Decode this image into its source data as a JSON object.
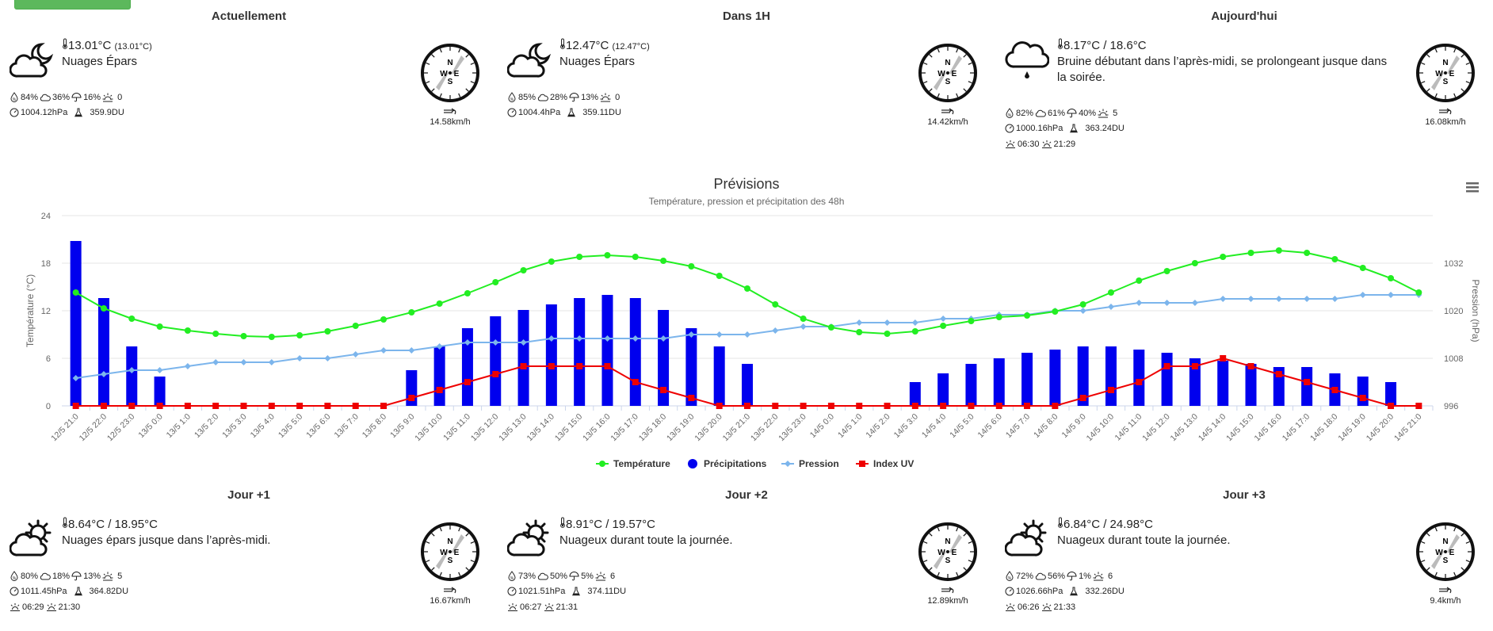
{
  "panels": [
    {
      "title": "Actuellement",
      "temp_main": "13.01°C",
      "temp_feel": "(13.01°C)",
      "desc": "Nuages Épars",
      "humidity": "84%",
      "cloud": "36%",
      "precip": "16%",
      "uv": "0",
      "pressure": "1004.12hPa",
      "ozone": "359.9DU",
      "sun": "",
      "wind": "14.58km/h",
      "icon": "partly-cloudy-night-icon"
    },
    {
      "title": "Dans 1H",
      "temp_main": "12.47°C",
      "temp_feel": "(12.47°C)",
      "desc": "Nuages Épars",
      "humidity": "85%",
      "cloud": "28%",
      "precip": "13%",
      "uv": "0",
      "pressure": "1004.4hPa",
      "ozone": "359.11DU",
      "sun": "",
      "wind": "14.42km/h",
      "icon": "partly-cloudy-night-icon"
    },
    {
      "title": "Aujourd'hui",
      "temp_main": "8.17°C /  18.6°C",
      "temp_feel": "",
      "desc": " Bruine débutant dans l’après-midi, se prolongeant jusque dans la soirée.",
      "humidity": "82%",
      "cloud": "61%",
      "precip": "40%",
      "uv": "5",
      "pressure": "1000.16hPa",
      "ozone": "363.24DU",
      "sunrise": "06:30",
      "sunset": "21:29",
      "wind": "16.08km/h",
      "icon": "drizzle-icon"
    },
    {
      "title": "Jour +1",
      "temp_main": "8.64°C /  18.95°C",
      "temp_feel": "",
      "desc": "Nuages épars jusque dans l’après-midi.",
      "humidity": "80%",
      "cloud": "18%",
      "precip": "13%",
      "uv": "5",
      "pressure": "1011.45hPa",
      "ozone": "364.82DU",
      "sunrise": "06:29",
      "sunset": "21:30",
      "wind": "16.67km/h",
      "icon": "partly-cloudy-day-icon"
    },
    {
      "title": "Jour +2",
      "temp_main": "8.91°C /  19.57°C",
      "temp_feel": "",
      "desc": "Nuageux durant toute la journée.",
      "humidity": "73%",
      "cloud": "50%",
      "precip": "5%",
      "uv": "6",
      "pressure": "1021.51hPa",
      "ozone": "374.11DU",
      "sunrise": "06:27",
      "sunset": "21:31",
      "wind": "12.89km/h",
      "icon": "partly-cloudy-day-icon"
    },
    {
      "title": "Jour +3",
      "temp_main": "6.84°C /  24.98°C",
      "temp_feel": "",
      "desc": "Nuageux durant toute la journée.",
      "humidity": "72%",
      "cloud": "56%",
      "precip": "1%",
      "uv": "6",
      "pressure": "1026.66hPa",
      "ozone": "332.26DU",
      "sunrise": "06:26",
      "sunset": "21:33",
      "wind": "9.4km/h",
      "icon": "partly-cloudy-day-icon"
    }
  ],
  "compass_labels": {
    "n": "N",
    "s": "S",
    "e": "E",
    "w": "W"
  },
  "chart_data": {
    "type": "bar",
    "title": "Prévisions",
    "subtitle": "Température, pression et précipitation des 48h",
    "ylabel_left": "Température (°C)",
    "ylabel_right": "Pression (hPa)",
    "yticks_left": [
      "0",
      "6",
      "12",
      "18",
      "24"
    ],
    "yticks_right": [
      "996",
      "1008",
      "1020",
      "1032"
    ],
    "ylim_left": [
      0,
      24
    ],
    "ylim_right": [
      996,
      1044
    ],
    "categories": [
      "12/5 21:0",
      "12/5 22:0",
      "12/5 23:0",
      "13/5 0:0",
      "13/5 1:0",
      "13/5 2:0",
      "13/5 3:0",
      "13/5 4:0",
      "13/5 5:0",
      "13/5 6:0",
      "13/5 7:0",
      "13/5 8:0",
      "13/5 9:0",
      "13/5 10:0",
      "13/5 11:0",
      "13/5 12:0",
      "13/5 13:0",
      "13/5 14:0",
      "13/5 15:0",
      "13/5 16:0",
      "13/5 17:0",
      "13/5 18:0",
      "13/5 19:0",
      "13/5 20:0",
      "13/5 21:0",
      "13/5 22:0",
      "13/5 23:0",
      "14/5 0:0",
      "14/5 1:0",
      "14/5 2:0",
      "14/5 3:0",
      "14/5 4:0",
      "14/5 5:0",
      "14/5 6:0",
      "14/5 7:0",
      "14/5 8:0",
      "14/5 9:0",
      "14/5 10:0",
      "14/5 11:0",
      "14/5 12:0",
      "14/5 13:0",
      "14/5 14:0",
      "14/5 15:0",
      "14/5 16:0",
      "14/5 17:0",
      "14/5 18:0",
      "14/5 19:0",
      "14/5 20:0",
      "14/5 21:0"
    ],
    "series": [
      {
        "name": "Température",
        "kind": "line",
        "color": "#22ee22",
        "axis": "left",
        "values": [
          14.3,
          12.3,
          11.0,
          10.0,
          9.5,
          9.1,
          8.8,
          8.7,
          8.9,
          9.4,
          10.1,
          10.9,
          11.8,
          12.9,
          14.2,
          15.6,
          17.1,
          18.2,
          18.8,
          19.0,
          18.8,
          18.3,
          17.6,
          16.4,
          14.8,
          12.8,
          11.0,
          9.9,
          9.3,
          9.1,
          9.4,
          10.1,
          10.7,
          11.2,
          11.4,
          11.9,
          12.8,
          14.3,
          15.8,
          17.0,
          18.0,
          18.8,
          19.3,
          19.6,
          19.3,
          18.5,
          17.4,
          16.1,
          14.3
        ]
      },
      {
        "name": "Précipitations",
        "kind": "bar",
        "color": "#0000ee",
        "axis": "left",
        "values": [
          20.8,
          13.6,
          7.5,
          3.7,
          0,
          0,
          0,
          0,
          0,
          0,
          0,
          0,
          4.5,
          7.5,
          9.8,
          11.3,
          12.1,
          12.8,
          13.6,
          14.0,
          13.6,
          12.1,
          9.8,
          7.5,
          5.3,
          0,
          0,
          0,
          0,
          0,
          3.0,
          4.1,
          5.3,
          6.0,
          6.7,
          7.1,
          7.5,
          7.5,
          7.1,
          6.7,
          6.0,
          5.7,
          5.3,
          4.9,
          4.9,
          4.1,
          3.7,
          3.0,
          0
        ]
      },
      {
        "name": "Pression",
        "kind": "line",
        "color": "#7cb5ec",
        "axis": "right",
        "values": [
          1003.0,
          1004.0,
          1005.0,
          1005.0,
          1006.0,
          1007.0,
          1007.0,
          1007.0,
          1008.0,
          1008.0,
          1009.0,
          1010.0,
          1010.0,
          1011.0,
          1012.0,
          1012.0,
          1012.0,
          1013.0,
          1013.0,
          1013.0,
          1013.0,
          1013.0,
          1014.0,
          1014.0,
          1014.0,
          1015.0,
          1016.0,
          1016.0,
          1017.0,
          1017.0,
          1017.0,
          1018.0,
          1018.0,
          1019.0,
          1019.0,
          1020.0,
          1020.0,
          1021.0,
          1022.0,
          1022.0,
          1022.0,
          1023.0,
          1023.0,
          1023.0,
          1023.0,
          1023.0,
          1024.0,
          1024.0,
          1024.0
        ]
      },
      {
        "name": "Index UV",
        "kind": "line",
        "color": "#ee0000",
        "axis": "left",
        "values": [
          0,
          0,
          0,
          0,
          0,
          0,
          0,
          0,
          0,
          0,
          0,
          0,
          1,
          2,
          3,
          4,
          5,
          5,
          5,
          5,
          3,
          2,
          1,
          0,
          0,
          0,
          0,
          0,
          0,
          0,
          0,
          0,
          0,
          0,
          0,
          0,
          1,
          2,
          3,
          5,
          5,
          6,
          5,
          4,
          3,
          2,
          1,
          0,
          0
        ]
      }
    ],
    "legend_position": "bottom-center",
    "grid": true
  }
}
